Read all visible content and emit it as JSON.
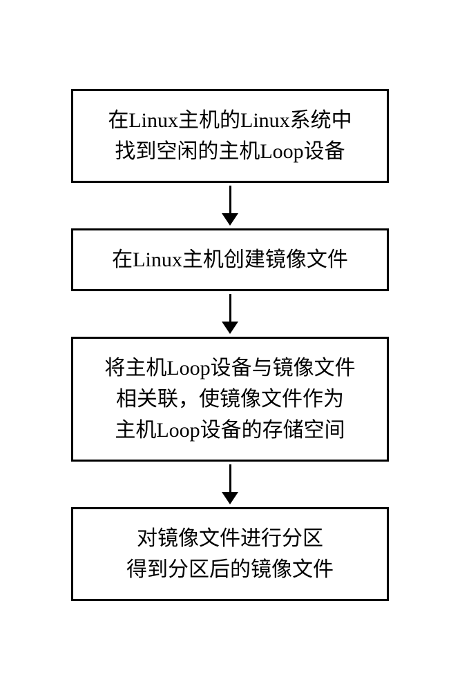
{
  "flowchart": {
    "steps": [
      {
        "text": "在Linux主机的Linux系统中\n找到空闲的主机Loop设备"
      },
      {
        "text": "在Linux主机创建镜像文件"
      },
      {
        "text": "将主机Loop设备与镜像文件\n相关联，使镜像文件作为\n主机Loop设备的存储空间"
      },
      {
        "text": "对镜像文件进行分区\n得到分区后的镜像文件"
      }
    ]
  }
}
